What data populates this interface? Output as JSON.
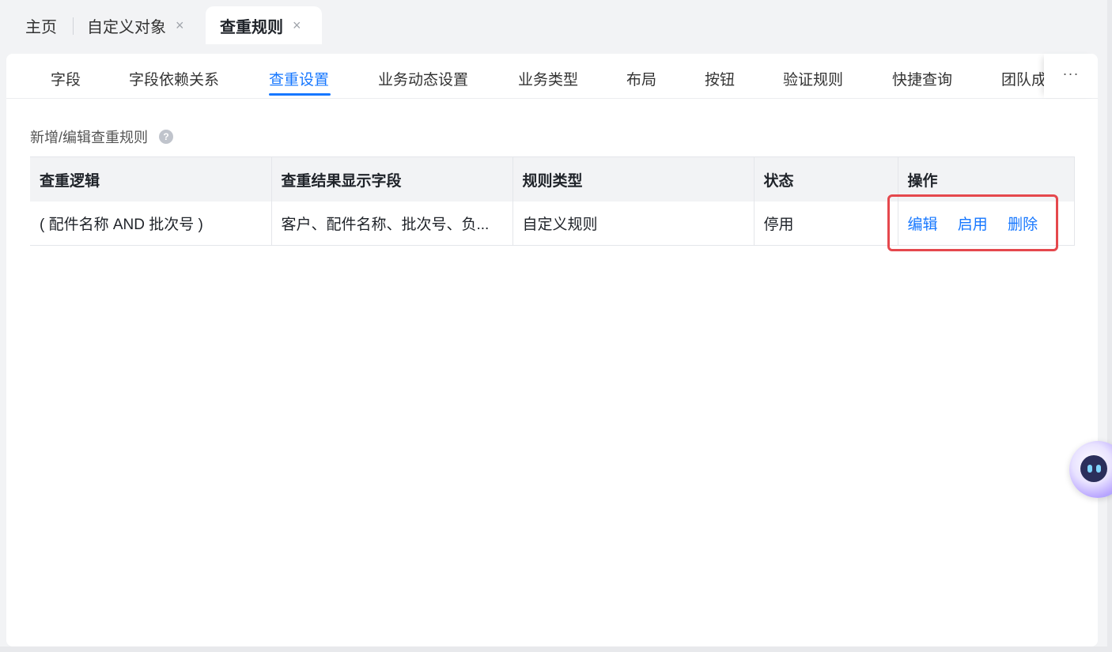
{
  "top_tabs": {
    "home": "主页",
    "custom_object": "自定义对象",
    "active": "查重规则",
    "close_glyph": "×"
  },
  "sub_tabs": [
    "字段",
    "字段依赖关系",
    "查重设置",
    "业务动态设置",
    "业务类型",
    "布局",
    "按钮",
    "验证规则",
    "快捷查询",
    "团队成"
  ],
  "sub_tabs_more": "···",
  "section": {
    "title": "新增/编辑查重规则",
    "help_icon": "?"
  },
  "table": {
    "headers": [
      "查重逻辑",
      "查重结果显示字段",
      "规则类型",
      "状态",
      "操作"
    ],
    "rows": [
      {
        "logic": "( 配件名称 AND 批次号 )",
        "fields": "客户、配件名称、批次号、负...",
        "type": "自定义规则",
        "status": "停用",
        "actions": [
          "编辑",
          "启用",
          "删除"
        ]
      }
    ]
  },
  "colors": {
    "accent": "#1677ff",
    "highlight": "#e5484d"
  }
}
